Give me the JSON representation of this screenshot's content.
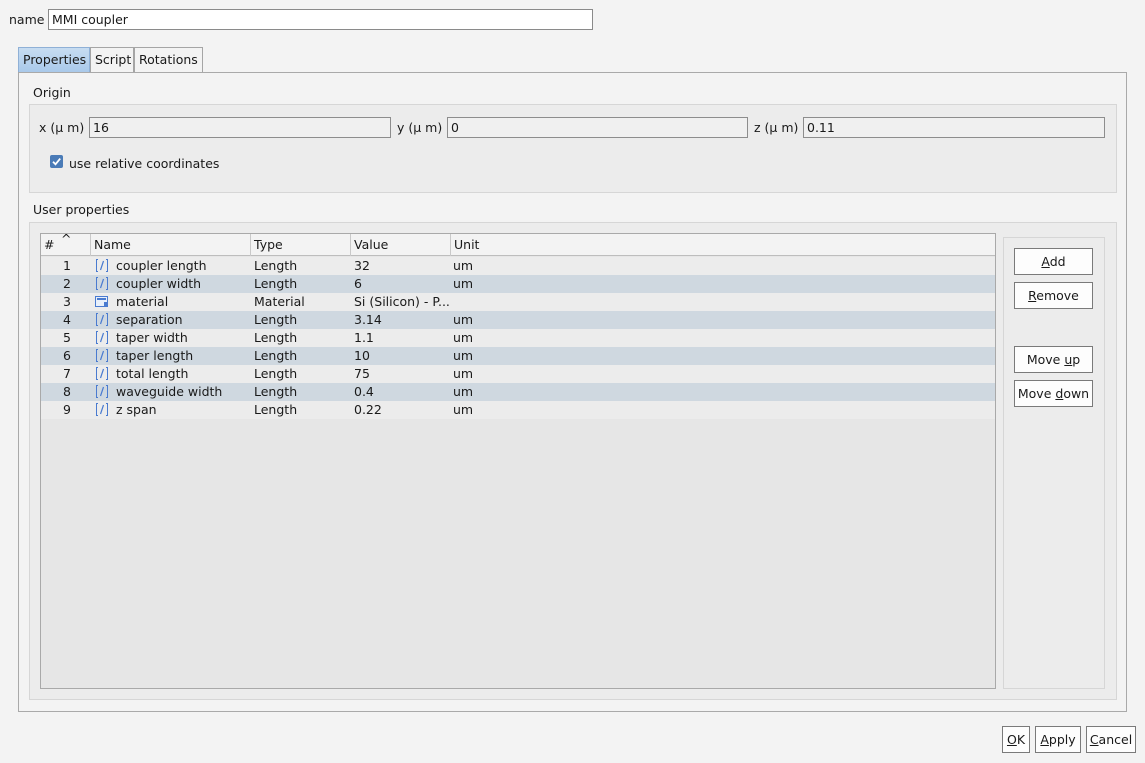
{
  "name_field": {
    "label": "name",
    "value": "MMI coupler"
  },
  "tabs": [
    {
      "label": "Properties",
      "active": true
    },
    {
      "label": "Script",
      "active": false
    },
    {
      "label": "Rotations",
      "active": false
    }
  ],
  "origin": {
    "title": "Origin",
    "x": {
      "label": "x (μ m)",
      "value": "16"
    },
    "y": {
      "label": "y (μ m)",
      "value": "0"
    },
    "z": {
      "label": "z (μ m)",
      "value": "0.11"
    },
    "relative": {
      "label": "use relative coordinates",
      "checked": true
    }
  },
  "user_props": {
    "title": "User properties",
    "columns": [
      "#",
      "Name",
      "Type",
      "Value",
      "Unit"
    ],
    "sort_indicator": "^",
    "rows": [
      {
        "num": "1",
        "icon": "length-icon",
        "name": "coupler length",
        "type": "Length",
        "value": "32",
        "unit": "um"
      },
      {
        "num": "2",
        "icon": "length-icon",
        "name": "coupler width",
        "type": "Length",
        "value": "6",
        "unit": "um"
      },
      {
        "num": "3",
        "icon": "material-icon",
        "name": "material",
        "type": "Material",
        "value": "Si (Silicon) - P...",
        "unit": ""
      },
      {
        "num": "4",
        "icon": "length-icon",
        "name": "separation",
        "type": "Length",
        "value": "3.14",
        "unit": "um"
      },
      {
        "num": "5",
        "icon": "length-icon",
        "name": "taper width",
        "type": "Length",
        "value": "1.1",
        "unit": "um"
      },
      {
        "num": "6",
        "icon": "length-icon",
        "name": "taper length",
        "type": "Length",
        "value": "10",
        "unit": "um"
      },
      {
        "num": "7",
        "icon": "length-icon",
        "name": "total length",
        "type": "Length",
        "value": "75",
        "unit": "um"
      },
      {
        "num": "8",
        "icon": "length-icon",
        "name": "waveguide width",
        "type": "Length",
        "value": "0.4",
        "unit": "um"
      },
      {
        "num": "9",
        "icon": "length-icon",
        "name": "z span",
        "type": "Length",
        "value": "0.22",
        "unit": "um"
      }
    ]
  },
  "side_buttons": {
    "add": {
      "pre": "",
      "u": "A",
      "post": "dd"
    },
    "remove": {
      "pre": "",
      "u": "R",
      "post": "emove"
    },
    "move_up": {
      "pre": "Move ",
      "u": "u",
      "post": "p"
    },
    "move_down": {
      "pre": "Move ",
      "u": "d",
      "post": "own"
    }
  },
  "footer_buttons": {
    "ok": {
      "pre": "",
      "u": "O",
      "post": "K"
    },
    "apply": {
      "pre": "",
      "u": "A",
      "post": "pply"
    },
    "cancel": {
      "pre": "",
      "u": "C",
      "post": "ancel"
    }
  },
  "colors": {
    "row_alt": "#cfd8e0",
    "tab_active": "#a9c9ea",
    "checkbox": "#4a7bb7",
    "icon": "#4a7bd0"
  }
}
